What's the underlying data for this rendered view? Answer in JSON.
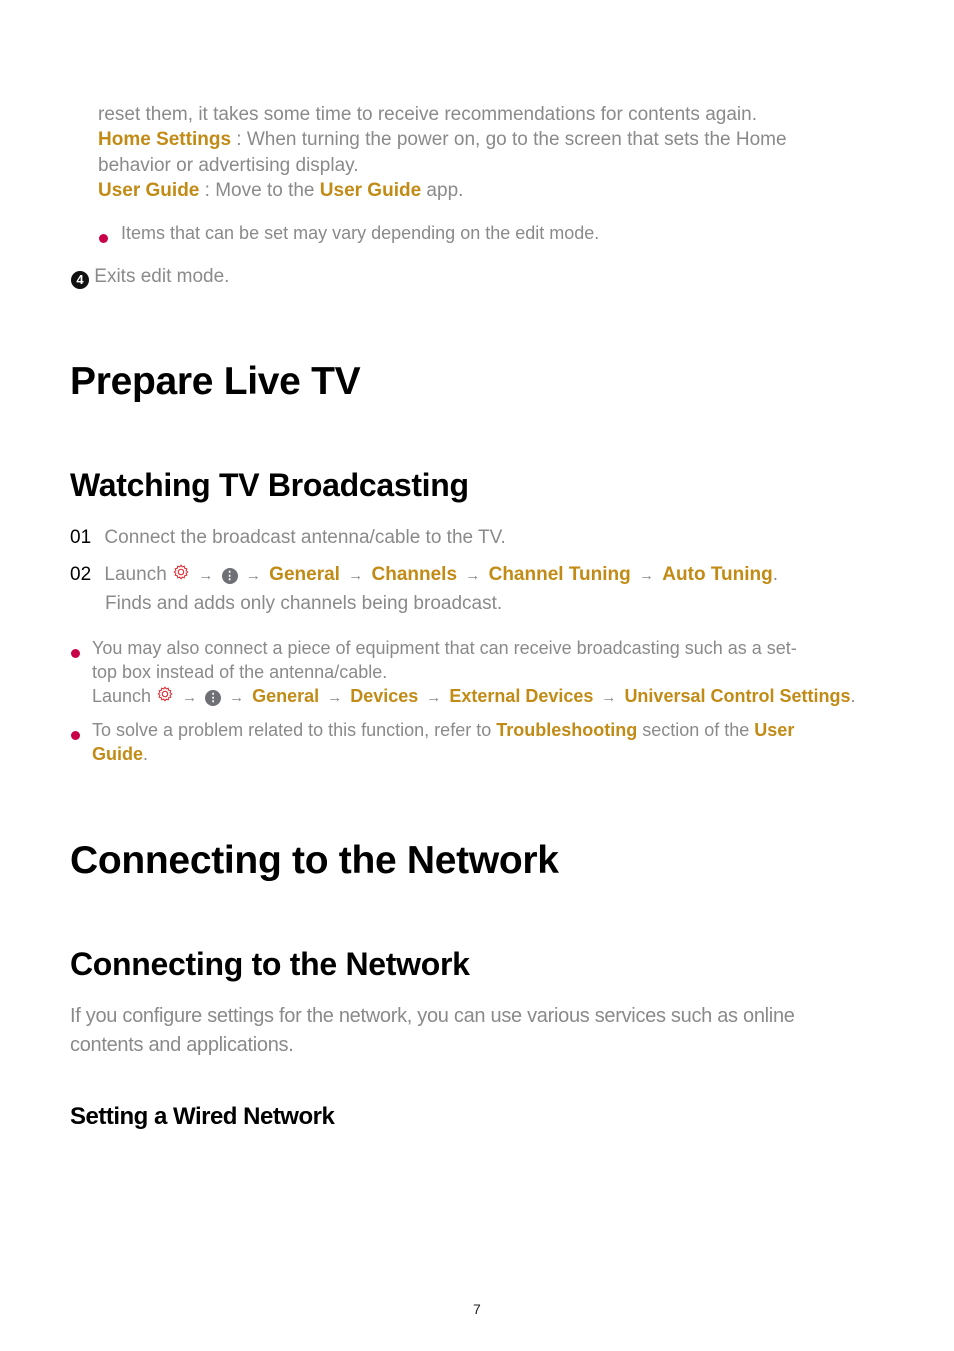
{
  "top": {
    "line1": "reset them, it takes some time to receive recommendations for contents again.",
    "home_settings": {
      "term": "Home Settings",
      "text1": " : When turning the power on, go to the screen that sets the Home",
      "text2": "behavior or advertising display."
    },
    "user_guide": {
      "term": "User Guide",
      "text": " : Move to the ",
      "link": "User Guide",
      "tail": " app."
    },
    "note": "Items that can be set may vary depending on the edit mode.",
    "step4": {
      "badge": "4",
      "text": "Exits edit mode."
    }
  },
  "section1": {
    "title": "Prepare Live TV",
    "subtitle": "Watching TV Broadcasting",
    "steps": [
      {
        "num": "01",
        "text": "Connect the broadcast antenna/cable to the TV."
      },
      {
        "num": "02",
        "launch": "Launch",
        "path": [
          "General",
          "Channels",
          "Channel Tuning",
          "Auto Tuning"
        ],
        "end": ".",
        "desc": "Finds and adds only channels being broadcast."
      }
    ],
    "notes": {
      "n1_line1": "You may also connect a piece of equipment that can receive broadcasting such as a set-",
      "n1_line2": "top box instead of the antenna/cable.",
      "n1_launch": "Launch",
      "n1_path": [
        "General",
        "Devices",
        "External Devices",
        "Universal Control Settings"
      ],
      "n1_end": ".",
      "n2_pre": "To solve a problem related to this function, refer to ",
      "n2_link": "Troubleshooting",
      "n2_mid": " section of the ",
      "n2_link2a": "User",
      "n2_link2b": "Guide",
      "n2_end": "."
    }
  },
  "section2": {
    "title": "Connecting to the Network",
    "subtitle": "Connecting to the Network",
    "para1": "If you configure settings for the network, you can use various services such as online",
    "para2": "contents and applications.",
    "sub3": "Setting a Wired Network"
  },
  "icons": {
    "settings": "gear-icon",
    "more": "info-dot-icon",
    "arrow": "→"
  },
  "colors": {
    "accent": "#c28b16",
    "bullet": "#c8004a",
    "body_text": "#8a8a8a"
  },
  "page_number": "7"
}
